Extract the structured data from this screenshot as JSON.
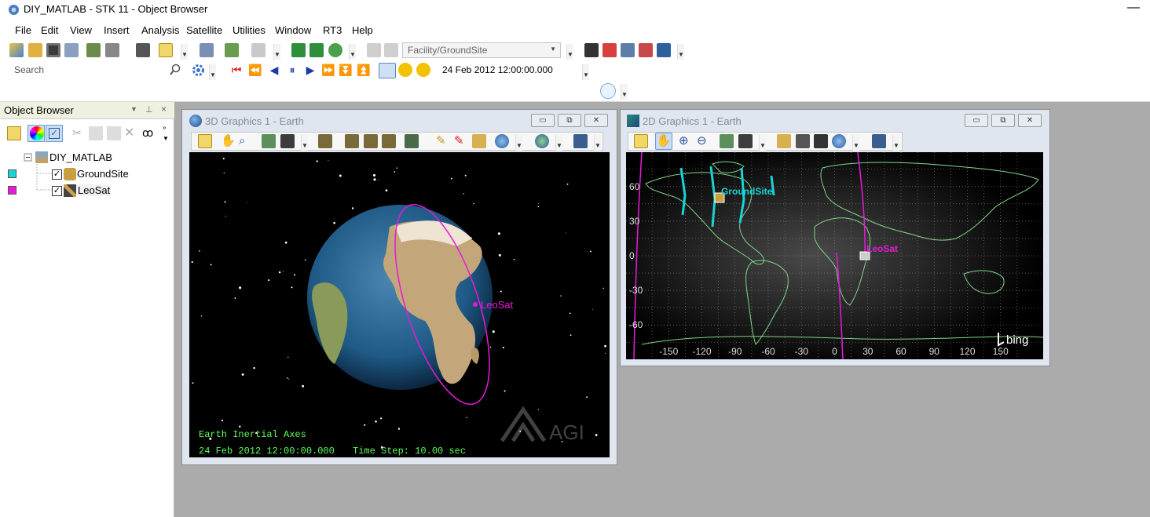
{
  "app": {
    "title": "DIY_MATLAB - STK 11 - Object Browser",
    "minimize_glyph": "—"
  },
  "menu": {
    "items": [
      "File",
      "Edit",
      "View",
      "Insert",
      "Analysis",
      "Satellite",
      "Utilities",
      "Window",
      "RT3",
      "Help"
    ]
  },
  "toolbar": {
    "object_selector_value": "Facility/GroundSite",
    "search_placeholder": "Search",
    "animation_time": "24 Feb 2012 12:00:00.000"
  },
  "object_browser": {
    "title": "Object Browser",
    "tree": [
      {
        "label": "DIY_MATLAB",
        "checked": false
      },
      {
        "label": "GroundSite",
        "checked": true,
        "color": "#19d3d6"
      },
      {
        "label": "LeoSat",
        "checked": true,
        "color": "#e81ad8"
      }
    ],
    "check_glyph": "✓"
  },
  "window_3d": {
    "title": "3D Graphics 1 - Earth",
    "satellite_label": "LeoSat",
    "axes_text": "Earth Inertial Axes",
    "time_text": "24 Feb 2012 12:00:00.000",
    "step_text": "Time Step: 10.00 sec",
    "watermark": "AGI"
  },
  "window_2d": {
    "title": "2D Graphics 1 - Earth",
    "ground_label": "GroundSite",
    "satellite_label": "LeoSat",
    "lat_ticks": [
      "60",
      "30",
      "0",
      "-30",
      "-60"
    ],
    "lon_ticks": [
      "-150",
      "-120",
      "-90",
      "-60",
      "-30",
      "0",
      "30",
      "60",
      "90",
      "120",
      "150"
    ],
    "bing_logo": "bing"
  },
  "colors": {
    "satellite": "#e81ad8",
    "groundsite": "#19d3d6",
    "overlay_text": "#5dff5d",
    "coastline": "#7fd68a"
  },
  "window_buttons": [
    "▭",
    "⧉",
    "✕"
  ]
}
